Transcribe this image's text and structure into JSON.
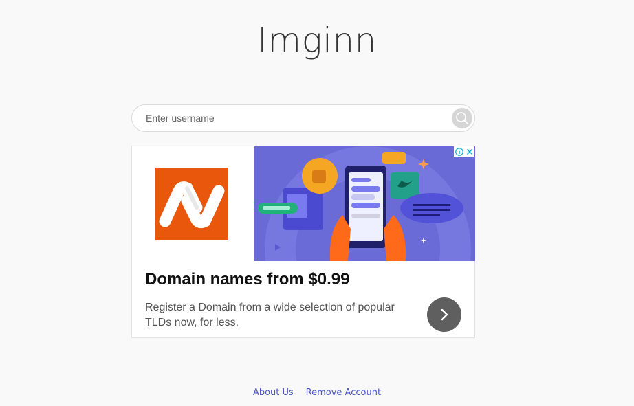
{
  "site": {
    "title": "Imginn"
  },
  "search": {
    "placeholder": "Enter username",
    "value": "",
    "icon": "search-icon"
  },
  "ad": {
    "headline": "Domain names from $0.99",
    "description": "Register a Domain from a wide selection of popular TLDs now, for less.",
    "brand_color": "#e8570c",
    "hero_color": "#6a6ad6",
    "cta_icon": "chevron-right-icon"
  },
  "footer": {
    "links": [
      {
        "label": "About Us"
      },
      {
        "label": "Remove Account"
      }
    ]
  },
  "colors": {
    "background": "#f9f9f9",
    "link": "#4a55c9"
  }
}
